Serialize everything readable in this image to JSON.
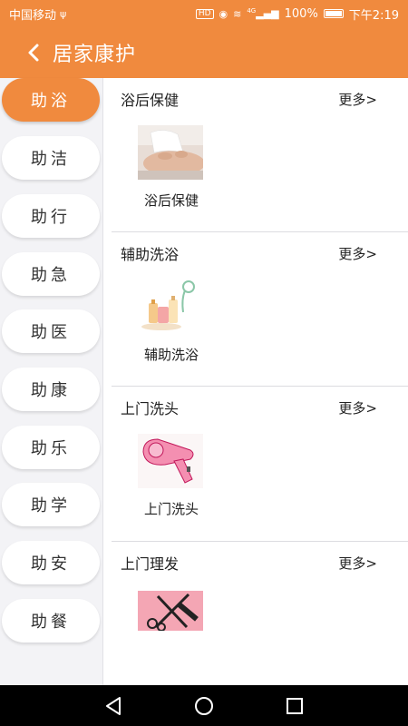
{
  "status_bar": {
    "carrier": "中国移动",
    "battery": "100%",
    "time": "下午2:19",
    "signal_label": "4G",
    "hd_label": "HD"
  },
  "header": {
    "title": "居家康护",
    "back_icon": "chevron-left-icon"
  },
  "sidebar": {
    "items": [
      {
        "label": "助浴",
        "active": true
      },
      {
        "label": "助洁"
      },
      {
        "label": "助行"
      },
      {
        "label": "助急"
      },
      {
        "label": "助医"
      },
      {
        "label": "助康"
      },
      {
        "label": "助乐"
      },
      {
        "label": "助学"
      },
      {
        "label": "助安"
      },
      {
        "label": "助餐"
      }
    ]
  },
  "sections": [
    {
      "title": "浴后保健",
      "more": "更多>",
      "item_label": "浴后保健",
      "image": "massage-photo"
    },
    {
      "title": "辅助洗浴",
      "more": "更多>",
      "item_label": "辅助洗浴",
      "image": "bath-products-image"
    },
    {
      "title": "上门洗头",
      "more": "更多>",
      "item_label": "上门洗头",
      "image": "hair-dryer-image"
    },
    {
      "title": "上门理发",
      "more": "更多>",
      "item_label": "",
      "image": "scissors-comb-image"
    }
  ],
  "colors": {
    "accent": "#f08a3e",
    "sidebar_bg": "#f3f3f6",
    "nav_bar": "#000000"
  }
}
